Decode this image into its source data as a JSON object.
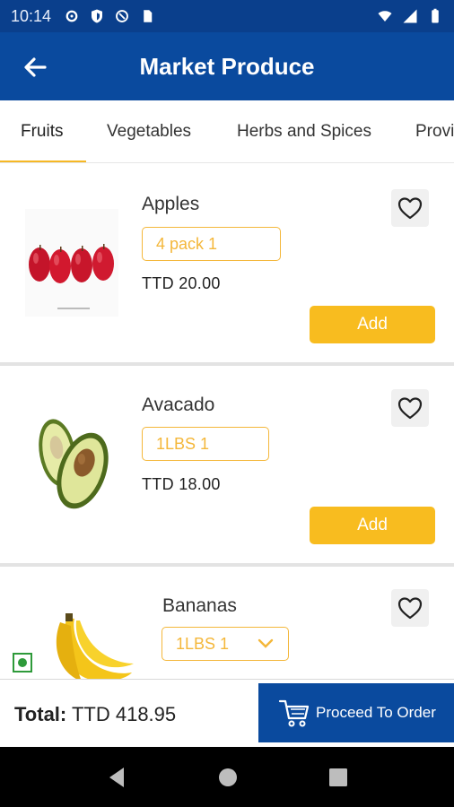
{
  "status_bar": {
    "time": "10:14"
  },
  "app_bar": {
    "title": "Market Produce"
  },
  "tabs": [
    {
      "label": "Fruits",
      "active": true
    },
    {
      "label": "Vegetables",
      "active": false
    },
    {
      "label": "Herbs and Spices",
      "active": false
    },
    {
      "label": "Provi",
      "active": false
    }
  ],
  "products": [
    {
      "name": "Apples",
      "variant": "4 pack 1",
      "price": "TTD 20.00",
      "add_label": "Add"
    },
    {
      "name": "Avacado",
      "variant": "1LBS 1",
      "price": "TTD 18.00",
      "add_label": "Add"
    },
    {
      "name": "Bananas",
      "variant": "1LBS 1"
    }
  ],
  "footer": {
    "total_label": "Total:",
    "total_value": "TTD 418.95",
    "order_label": "Proceed To Order"
  },
  "colors": {
    "primary": "#0a4a9e",
    "accent": "#f8bc1f",
    "status_bar": "#0a3f8c"
  }
}
